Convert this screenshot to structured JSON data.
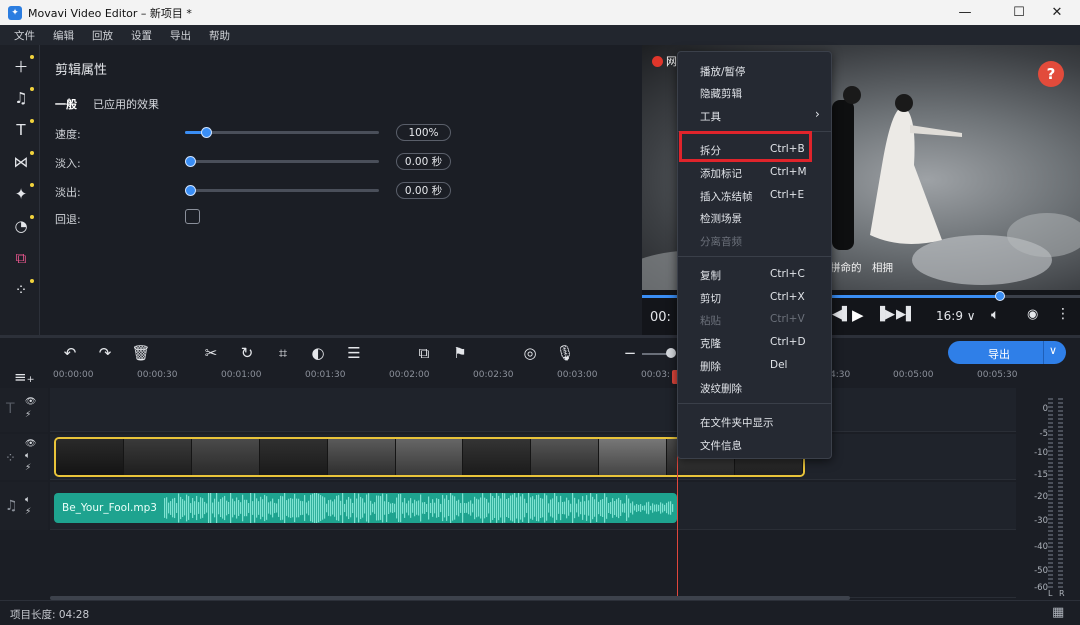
{
  "window": {
    "title": "Movavi Video Editor – 新项目 *",
    "minimize": "—",
    "maximize": "☐",
    "close": "✕"
  },
  "menubar": [
    "文件",
    "编辑",
    "回放",
    "设置",
    "导出",
    "帮助"
  ],
  "left_toolbar": [
    "add-media",
    "music",
    "titles",
    "transitions",
    "stickers",
    "filters",
    "elements",
    "more"
  ],
  "properties": {
    "heading": "剪辑属性",
    "tabs": [
      "一般",
      "已应用的效果"
    ],
    "active_tab": "一般",
    "speed": {
      "label": "速度:",
      "value": "100%",
      "level": 0.1
    },
    "fade_in": {
      "label": "淡入:",
      "value": "0.00 秒",
      "level": 0
    },
    "fade_out": {
      "label": "淡出:",
      "value": "0.00 秒",
      "level": 0
    },
    "reverse": {
      "label": "回退:",
      "checked": false
    }
  },
  "preview": {
    "watermark": "网",
    "subtitle": "拼命的　相拥",
    "timecode": "00:",
    "aspect": "16:9 ∨",
    "help": "?",
    "progress": 0.9
  },
  "context_menu": {
    "items": [
      {
        "label": "播放/暂停",
        "shortcut": ""
      },
      {
        "label": "隐藏剪辑",
        "shortcut": ""
      },
      {
        "label": "工具",
        "shortcut": "›"
      },
      {
        "label": "拆分",
        "shortcut": "Ctrl+B"
      },
      {
        "label": "添加标记",
        "shortcut": "Ctrl+M"
      },
      {
        "label": "插入冻结帧",
        "shortcut": "Ctrl+E"
      },
      {
        "label": "检测场景",
        "shortcut": ""
      },
      {
        "label": "分离音频",
        "shortcut": ""
      },
      {
        "label": "复制",
        "shortcut": "Ctrl+C"
      },
      {
        "label": "剪切",
        "shortcut": "Ctrl+X"
      },
      {
        "label": "粘贴",
        "shortcut": "Ctrl+V"
      },
      {
        "label": "克隆",
        "shortcut": "Ctrl+D"
      },
      {
        "label": "删除",
        "shortcut": "Del"
      },
      {
        "label": "波纹删除",
        "shortcut": ""
      },
      {
        "label": "在文件夹中显示",
        "shortcut": ""
      },
      {
        "label": "文件信息",
        "shortcut": ""
      }
    ]
  },
  "timeline": {
    "export_label": "导出",
    "ruler": [
      "00:00:00",
      "00:00:30",
      "00:01:00",
      "00:01:30",
      "00:02:00",
      "00:02:30",
      "00:03:00",
      "00:03:",
      "",
      "4:30",
      "00:05:00",
      "00:05:30"
    ],
    "audio_clip": "Be_Your_Fool.mp3",
    "meter_labels": [
      "0",
      "-5",
      "-10",
      "-15",
      "-20",
      "-30",
      "-40",
      "-50",
      "-60"
    ],
    "meter_lr": [
      "L",
      "R"
    ]
  },
  "status": {
    "project_length": "项目长度: 04:28"
  }
}
